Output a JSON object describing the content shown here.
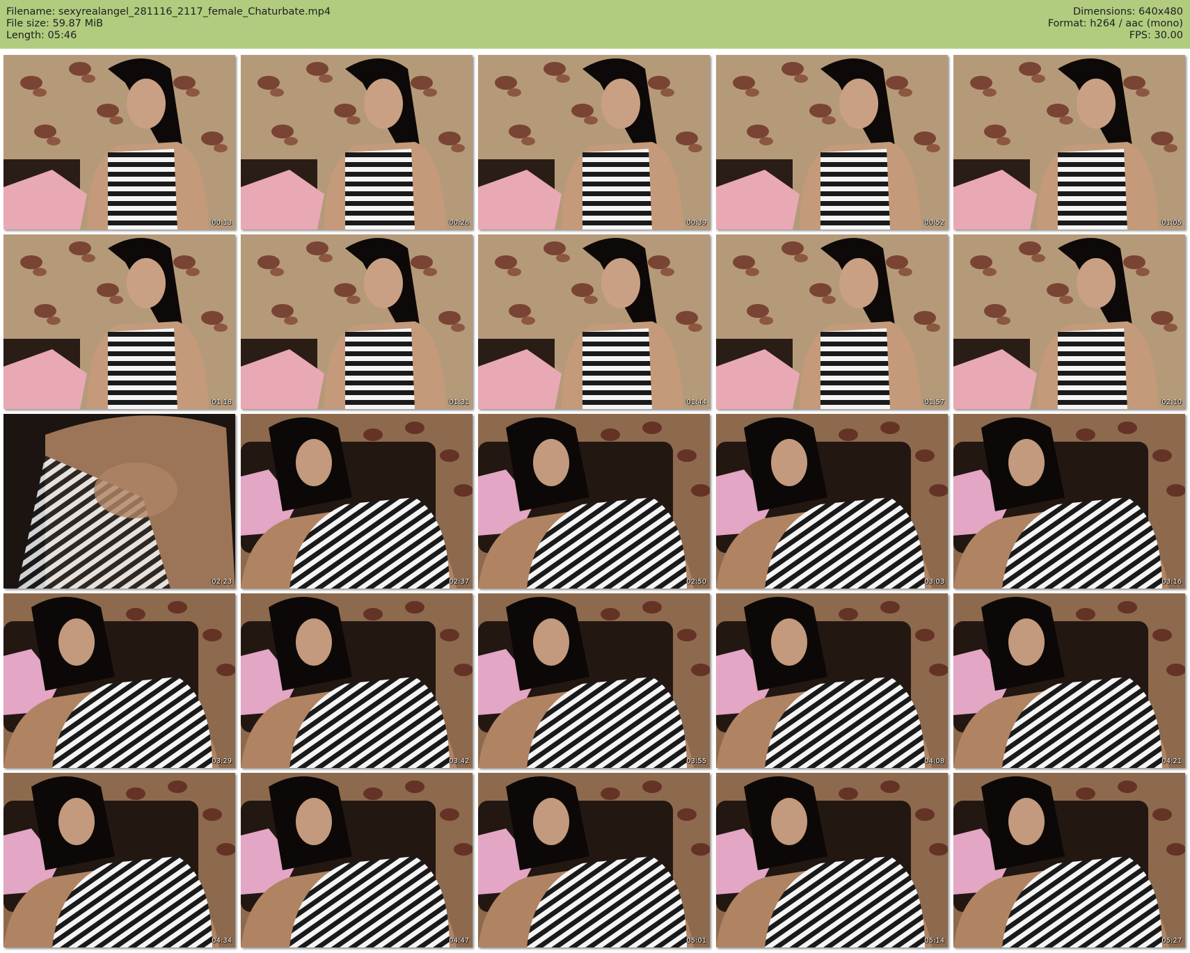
{
  "header": {
    "filename_line": "Filename: sexyrealangel_281116_2117_female_Chaturbate.mp4",
    "filesize_line": "File size: 59.87 MiB",
    "length_line": "Length: 05:46",
    "dimensions_line": "Dimensions: 640x480",
    "format_line": "Format: h264 / aac (mono)",
    "fps_line": "FPS: 30.00",
    "background_color": "#b1cc7f"
  },
  "thumbnails": [
    {
      "time": "00:13",
      "scene": "wallpaper-seated"
    },
    {
      "time": "00:26",
      "scene": "wallpaper-seated"
    },
    {
      "time": "00:39",
      "scene": "wallpaper-seated"
    },
    {
      "time": "00:52",
      "scene": "wallpaper-seated"
    },
    {
      "time": "01:05",
      "scene": "wallpaper-seated"
    },
    {
      "time": "01:18",
      "scene": "wallpaper-seated"
    },
    {
      "time": "01:31",
      "scene": "wallpaper-seated"
    },
    {
      "time": "01:44",
      "scene": "wallpaper-seated"
    },
    {
      "time": "01:57",
      "scene": "wallpaper-seated"
    },
    {
      "time": "02:10",
      "scene": "wallpaper-seated"
    },
    {
      "time": "02:23",
      "scene": "close-up-blur"
    },
    {
      "time": "02:37",
      "scene": "reclining"
    },
    {
      "time": "02:50",
      "scene": "reclining"
    },
    {
      "time": "03:03",
      "scene": "reclining"
    },
    {
      "time": "03:16",
      "scene": "reclining"
    },
    {
      "time": "03:29",
      "scene": "reclining"
    },
    {
      "time": "03:42",
      "scene": "reclining"
    },
    {
      "time": "03:55",
      "scene": "reclining"
    },
    {
      "time": "04:08",
      "scene": "reclining"
    },
    {
      "time": "04:21",
      "scene": "reclining"
    },
    {
      "time": "04:34",
      "scene": "reclining"
    },
    {
      "time": "04:47",
      "scene": "reclining"
    },
    {
      "time": "05:01",
      "scene": "reclining"
    },
    {
      "time": "05:14",
      "scene": "reclining"
    },
    {
      "time": "05:27",
      "scene": "reclining"
    }
  ]
}
